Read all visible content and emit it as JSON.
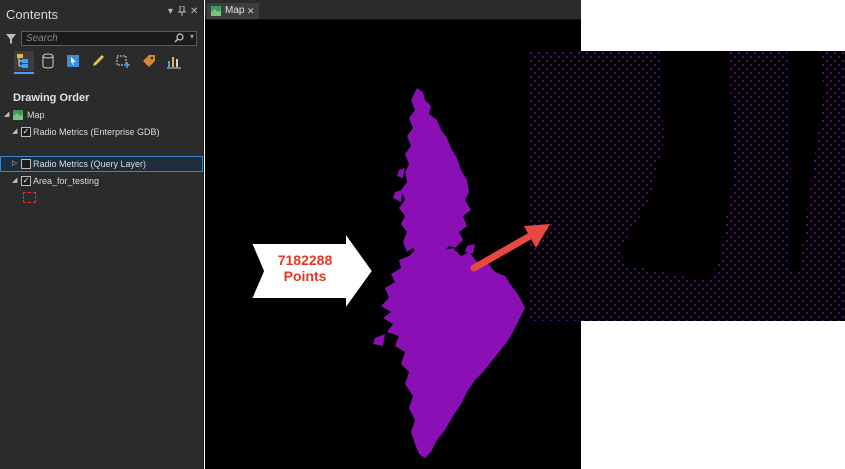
{
  "contents_pane": {
    "title": "Contents",
    "controls": {
      "menu": "▾",
      "pin": "ᵖ",
      "close": "✕"
    },
    "search": {
      "placeholder": "Search"
    },
    "toolbar_icons": [
      "list-by-drawing-order-icon",
      "list-by-data-source-icon",
      "list-by-selection-icon",
      "list-by-editing-icon",
      "list-by-snapping-icon",
      "list-by-labeling-icon",
      "list-by-charts-icon"
    ],
    "section_title": "Drawing Order",
    "layers": [
      {
        "name": "Map",
        "checked": null,
        "expanded": true
      },
      {
        "name": "Radio Metrics (Enterprise GDB)",
        "checked": true,
        "expanded": true
      },
      {
        "name": "Radio Metrics (Query Layer)",
        "checked": false,
        "expanded": false,
        "selected": true
      },
      {
        "name": "Area_for_testing",
        "checked": true,
        "expanded": true
      }
    ]
  },
  "map_view": {
    "tab_label": "Map",
    "point_color": "#8a0fb5",
    "inset_point_color": "#8f14d9"
  },
  "annotation": {
    "count": "7182288",
    "unit": "Points",
    "text_color": "#e4392a",
    "arrow_color": "#e8483f"
  }
}
